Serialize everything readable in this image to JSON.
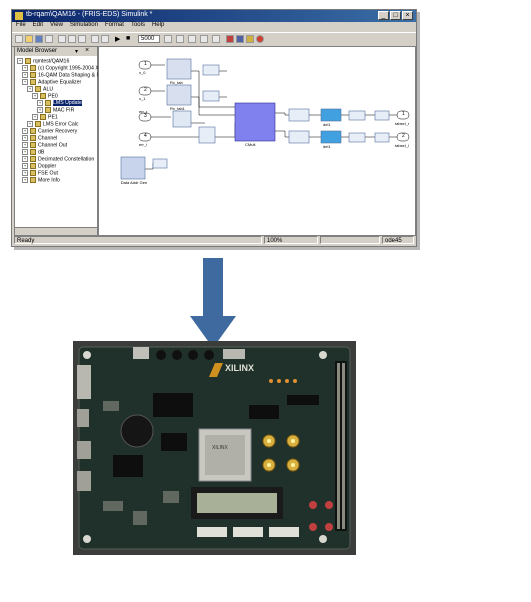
{
  "window": {
    "title": "tb-rqam\\QAM16 - (FRIS-EDS) Simulink *",
    "menu": [
      "File",
      "Edit",
      "View",
      "Simulation",
      "Format",
      "Tools",
      "Help"
    ],
    "stop_time": "5000",
    "controls": {
      "minimize": "_",
      "maximize": "□",
      "close": "×"
    }
  },
  "model_browser": {
    "title": "Model Browser",
    "items": [
      {
        "label": "rqmtest/QAM16",
        "indent": 0,
        "selected": false
      },
      {
        "label": "(c) Copyright 1995-2004 Xilinx",
        "indent": 1,
        "selected": false
      },
      {
        "label": "16-QAM Data Shaping & Interp",
        "indent": 1,
        "selected": false
      },
      {
        "label": "Adaptive Equalizer",
        "indent": 1,
        "selected": false
      },
      {
        "label": "ALU",
        "indent": 2,
        "selected": false
      },
      {
        "label": "PE0",
        "indent": 3,
        "selected": false
      },
      {
        "label": "LMS Update",
        "indent": 4,
        "selected": true
      },
      {
        "label": "MAC FIR",
        "indent": 4,
        "selected": false
      },
      {
        "label": "PE1",
        "indent": 3,
        "selected": false
      },
      {
        "label": "LMS Error Calc",
        "indent": 2,
        "selected": false
      },
      {
        "label": "Carrier Recovery",
        "indent": 1,
        "selected": false
      },
      {
        "label": "Channel",
        "indent": 1,
        "selected": false
      },
      {
        "label": "Channel Out",
        "indent": 1,
        "selected": false
      },
      {
        "label": "dB",
        "indent": 1,
        "selected": false
      },
      {
        "label": "Decimated Constellation",
        "indent": 1,
        "selected": false
      },
      {
        "label": "Doppler",
        "indent": 1,
        "selected": false
      },
      {
        "label": "FSE Out",
        "indent": 1,
        "selected": false
      },
      {
        "label": "More Info",
        "indent": 1,
        "selected": false
      }
    ]
  },
  "diagram": {
    "inports": [
      "1",
      "2",
      "3",
      "4"
    ],
    "inport_labels": [
      "x_0",
      "x_1",
      "err_r",
      "err_i"
    ],
    "block_labels": [
      "Rx_tab",
      "Rx_tab1",
      "CMult",
      "Data Addr Gen",
      "del1",
      "del1"
    ],
    "outports": [
      "1",
      "2"
    ],
    "outport_labels": [
      "tabsel_r",
      "tabsel_i"
    ]
  },
  "status": {
    "left": "Ready",
    "zoom": "100%",
    "solver": "ode45"
  },
  "arrow_color": "#3f6aa0"
}
